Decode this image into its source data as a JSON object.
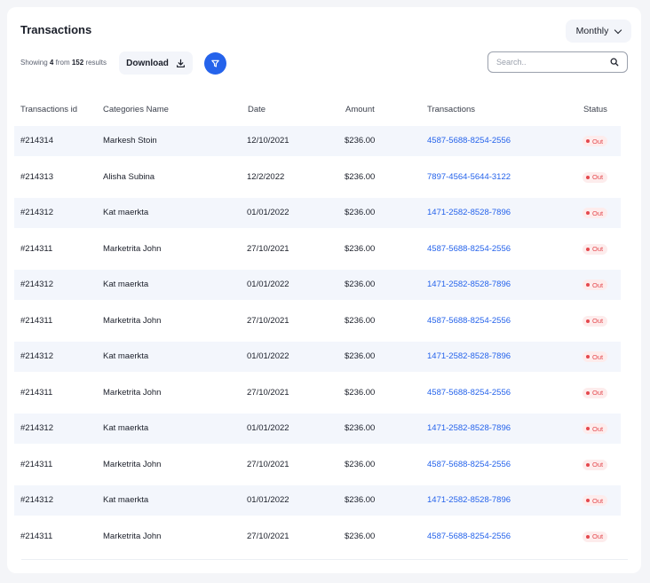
{
  "header": {
    "title": "Transactions",
    "period": "Monthly"
  },
  "toolbar": {
    "showing_prefix": "Showing",
    "showing_count": "4",
    "showing_mid": "from",
    "showing_total": "152",
    "showing_suffix": "results",
    "download_label": "Download",
    "search_placeholder": "Search..",
    "accent_color": "#2563eb"
  },
  "table": {
    "columns": [
      "Transactions id",
      "Categories Name",
      "Date",
      "Amount",
      "Transactions",
      "Status"
    ],
    "rows": [
      {
        "id": "#214314",
        "name": "Markesh Stoin",
        "date": "12/10/2021",
        "amount": "$236.00",
        "tx": "4587-5688-8254-2556",
        "status": "Out"
      },
      {
        "id": "#214313",
        "name": "Alisha Subina",
        "date": "12/2/2022",
        "amount": "$236.00",
        "tx": "7897-4564-5644-3122",
        "status": "Out"
      },
      {
        "id": "#214312",
        "name": "Kat maerkta",
        "date": "01/01/2022",
        "amount": "$236.00",
        "tx": "1471-2582-8528-7896",
        "status": "Out"
      },
      {
        "id": "#214311",
        "name": "Marketrita John",
        "date": "27/10/2021",
        "amount": "$236.00",
        "tx": "4587-5688-8254-2556",
        "status": "Out"
      },
      {
        "id": "#214312",
        "name": "Kat maerkta",
        "date": "01/01/2022",
        "amount": "$236.00",
        "tx": "1471-2582-8528-7896",
        "status": "Out"
      },
      {
        "id": "#214311",
        "name": "Marketrita John",
        "date": "27/10/2021",
        "amount": "$236.00",
        "tx": "4587-5688-8254-2556",
        "status": "Out"
      },
      {
        "id": "#214312",
        "name": "Kat maerkta",
        "date": "01/01/2022",
        "amount": "$236.00",
        "tx": "1471-2582-8528-7896",
        "status": "Out"
      },
      {
        "id": "#214311",
        "name": "Marketrita John",
        "date": "27/10/2021",
        "amount": "$236.00",
        "tx": "4587-5688-8254-2556",
        "status": "Out"
      },
      {
        "id": "#214312",
        "name": "Kat maerkta",
        "date": "01/01/2022",
        "amount": "$236.00",
        "tx": "1471-2582-8528-7896",
        "status": "Out"
      },
      {
        "id": "#214311",
        "name": "Marketrita John",
        "date": "27/10/2021",
        "amount": "$236.00",
        "tx": "4587-5688-8254-2556",
        "status": "Out"
      },
      {
        "id": "#214312",
        "name": "Kat maerkta",
        "date": "01/01/2022",
        "amount": "$236.00",
        "tx": "1471-2582-8528-7896",
        "status": "Out"
      },
      {
        "id": "#214311",
        "name": "Marketrita John",
        "date": "27/10/2021",
        "amount": "$236.00",
        "tx": "4587-5688-8254-2556",
        "status": "Out"
      }
    ]
  }
}
